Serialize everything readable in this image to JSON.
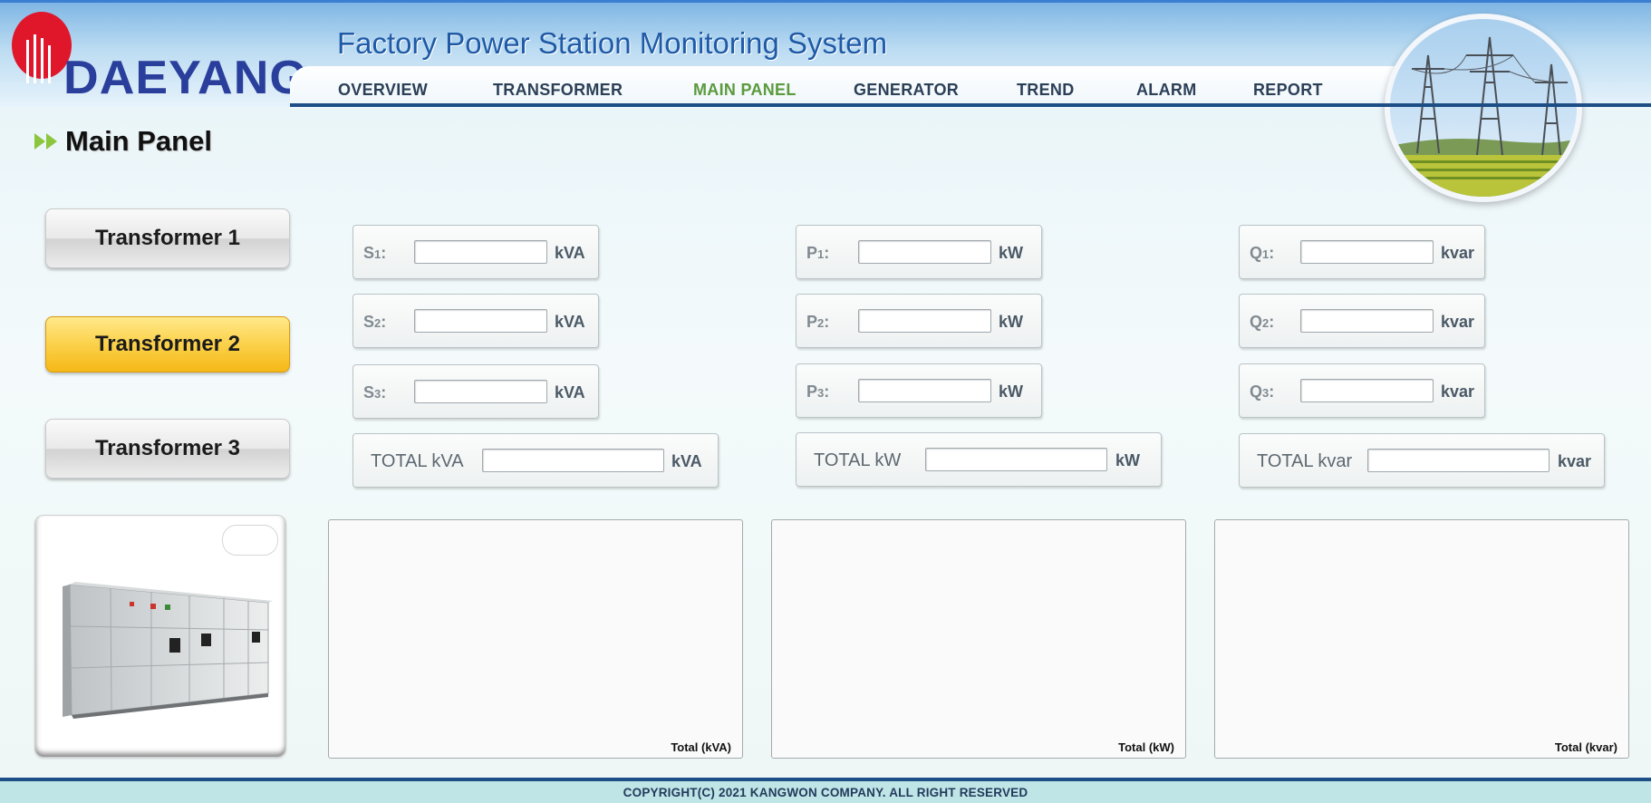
{
  "brand": {
    "logo_text": "DAEYANG",
    "app_title": "Factory Power Station Monitoring System"
  },
  "nav": {
    "items": [
      {
        "label": "OVERVIEW",
        "active": false
      },
      {
        "label": "TRANSFORMER",
        "active": false
      },
      {
        "label": "MAIN PANEL",
        "active": true
      },
      {
        "label": "GENERATOR",
        "active": false
      },
      {
        "label": "TREND",
        "active": false
      },
      {
        "label": "ALARM",
        "active": false
      },
      {
        "label": "REPORT",
        "active": false
      }
    ],
    "active_color": "#5b9a3d"
  },
  "page": {
    "title": "Main Panel"
  },
  "transformers": {
    "selected": "Transformer 2",
    "buttons": [
      {
        "label": "Transformer 1"
      },
      {
        "label": "Transformer 2"
      },
      {
        "label": "Transformer 3"
      }
    ]
  },
  "measurements": {
    "apparent": {
      "rows": [
        {
          "letter": "S",
          "num": "1",
          "colon": ":",
          "value": "",
          "unit": "kVA"
        },
        {
          "letter": "S",
          "num": "2",
          "colon": ":",
          "value": "",
          "unit": "kVA"
        },
        {
          "letter": "S",
          "num": "3",
          "colon": ":",
          "value": "",
          "unit": "kVA"
        }
      ],
      "total": {
        "label": "TOTAL kVA",
        "value": "",
        "unit": "kVA"
      },
      "chart_caption": "Total (kVA)"
    },
    "active": {
      "rows": [
        {
          "letter": "P",
          "num": "1",
          "colon": ":",
          "value": "",
          "unit": "kW"
        },
        {
          "letter": "P",
          "num": "2",
          "colon": ":",
          "value": "",
          "unit": "kW"
        },
        {
          "letter": "P",
          "num": "3",
          "colon": ":",
          "value": "",
          "unit": "kW"
        }
      ],
      "total": {
        "label": "TOTAL kW",
        "value": "",
        "unit": "kW"
      },
      "chart_caption": "Total (kW)"
    },
    "reactive": {
      "rows": [
        {
          "letter": "Q",
          "num": "1",
          "colon": ":",
          "value": "",
          "unit": "kvar"
        },
        {
          "letter": "Q",
          "num": "2",
          "colon": ":",
          "value": "",
          "unit": "kvar"
        },
        {
          "letter": "Q",
          "num": "3",
          "colon": ":",
          "value": "",
          "unit": "kvar"
        }
      ],
      "total": {
        "label": "TOTAL kvar",
        "value": "",
        "unit": "kvar"
      },
      "chart_caption": "Total (kvar)"
    }
  },
  "footer": {
    "copyright": "COPYRIGHT(C) 2021 KANGWON COMPANY. ALL RIGHT RESERVED"
  },
  "colors": {
    "brand_blue": "#2a3f9c",
    "logo_red": "#e0162b",
    "selected_button": "#fbd14a",
    "header_line": "#1d4f86"
  },
  "icons": {
    "page_title_marker": "double-arrow-icon",
    "logo_mark": "daeyang-logo-icon"
  }
}
